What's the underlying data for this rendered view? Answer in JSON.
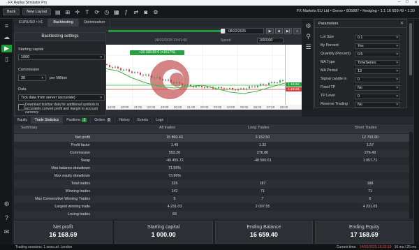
{
  "window": {
    "title": "FX Replay Simulator Pro"
  },
  "toolbar": {
    "back_label": "Back",
    "new_layout_label": "New Layout",
    "account_info": "FX Markets EU Ltd • Demo • 805887 • Hedging • 1:1 16 659.49 • 1:30"
  },
  "tabs": [
    {
      "label": "EURUSD • h1"
    },
    {
      "label": "Backtesting"
    },
    {
      "label": "Optimization"
    }
  ],
  "chart": {
    "date_value": "08/22/2025",
    "info_text": "08/22/2025 23:01:00",
    "speed_label": "Speed",
    "speed_value": "1000000",
    "profit_label": "+16 168.69 € (+1617%)",
    "price_green": "1.16164",
    "price_red": "1.16131",
    "x_ticks": [
      "19:00",
      "20:00",
      "21:00",
      "22:00",
      "23:00",
      "00:00",
      "01:00",
      "02:00",
      "03:00",
      "04:00",
      "05:00",
      "06:00",
      "07:00",
      "08:00"
    ]
  },
  "backtest_settings": {
    "title": "Backtesting settings",
    "starting_capital_label": "Starting capital",
    "starting_capital_value": "1000",
    "commission_label": "Commission",
    "commission_value": "30",
    "commission_unit": "per Million",
    "data_label": "Data",
    "data_value": "Tick data from server (accurate)",
    "checkbox_label": "Download tick/bar data for additional symbols to accurately convert profit and margin to account currency"
  },
  "parameters": {
    "title": "Parameters",
    "rows": [
      {
        "label": "Lot Size",
        "value": "0.1"
      },
      {
        "label": "By Percent",
        "value": "Yes"
      },
      {
        "label": "Quantity (Percent)",
        "value": "0.5"
      },
      {
        "label": "MA Type",
        "value": "TimeSeries"
      },
      {
        "label": "MA Period",
        "value": "13"
      },
      {
        "label": "Signal candle in",
        "value": "0"
      },
      {
        "label": "Fixed TP",
        "value": "No"
      },
      {
        "label": "TP Level",
        "value": "0"
      },
      {
        "label": "Reverse Trading",
        "value": "No"
      }
    ]
  },
  "bottom_tabs": [
    {
      "label": "Equity"
    },
    {
      "label": "Trade Statistics"
    },
    {
      "label": "Positions",
      "badge": "1"
    },
    {
      "label": "Orders",
      "badge": "0"
    },
    {
      "label": "History"
    },
    {
      "label": "Events"
    },
    {
      "label": "Logs"
    }
  ],
  "summary_table": {
    "headers": [
      "Summary",
      "All trades",
      "Long Trades",
      "Short Trades"
    ],
    "rows": [
      [
        "Net profit",
        "15 860.40",
        "3 152.50",
        "12 703.90"
      ],
      [
        "Profit factor",
        "1.49",
        "1.32",
        "1.57"
      ],
      [
        "Commission",
        "553.26",
        "276.80",
        "276.43"
      ],
      [
        "Swap",
        "-49 455.72",
        "-48 500.61",
        "1 057.71"
      ],
      [
        "Max balance drawdown",
        "71.56%",
        "",
        ""
      ],
      [
        "Max equity drawdown",
        "73.96%",
        "",
        ""
      ],
      [
        "Total trades",
        "225",
        "187",
        "188"
      ],
      [
        "Winning trades",
        "142",
        "71",
        "71"
      ],
      [
        "Max Consecutive Winning Trades",
        "5",
        "7",
        "6"
      ],
      [
        "Largest winning trade",
        "4 231.03",
        "2 097.55",
        "4 231.03"
      ],
      [
        "Losing trades",
        "83",
        "",
        ""
      ]
    ]
  },
  "cards": [
    {
      "label": "Net profit",
      "value": "16 168.69"
    },
    {
      "label": "Starting capital",
      "value": "1 000.00"
    },
    {
      "label": "Ending Balance",
      "value": "16 659.40"
    },
    {
      "label": "Ending Equity",
      "value": "17 168.69"
    }
  ],
  "status": {
    "left": "Trading sessions: 1 sess,ud: London",
    "right_label": "Current time:",
    "right_time": "14/03/2025 16:33:19",
    "right_extra": "16 ms / 25 ms"
  }
}
